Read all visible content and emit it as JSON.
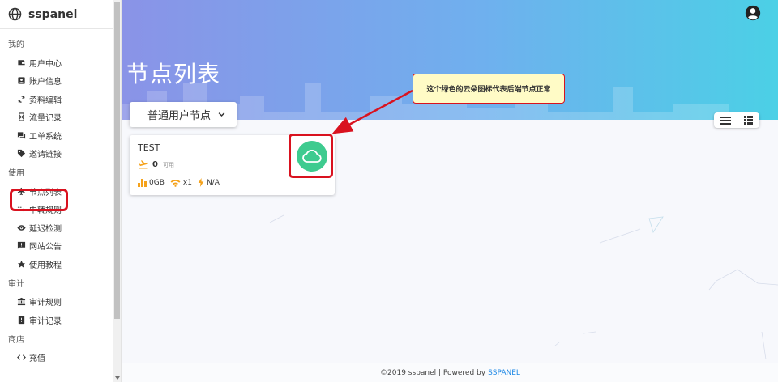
{
  "brand": {
    "name": "sspanel"
  },
  "sidebar": {
    "sections": [
      {
        "title": "我的",
        "items": [
          {
            "label": "用户中心",
            "icon": "wallet-icon"
          },
          {
            "label": "账户信息",
            "icon": "account-box-icon"
          },
          {
            "label": "资料编辑",
            "icon": "sync-icon"
          },
          {
            "label": "流量记录",
            "icon": "hourglass-icon"
          },
          {
            "label": "工单系统",
            "icon": "forum-icon"
          },
          {
            "label": "邀请链接",
            "icon": "tag-icon"
          }
        ]
      },
      {
        "title": "使用",
        "items": [
          {
            "label": "节点列表",
            "icon": "airplane-icon",
            "active": true
          },
          {
            "label": "中转规则",
            "icon": "transfer-icon"
          },
          {
            "label": "延迟检测",
            "icon": "eye-icon"
          },
          {
            "label": "网站公告",
            "icon": "announcement-icon"
          },
          {
            "label": "使用教程",
            "icon": "star-icon"
          }
        ]
      },
      {
        "title": "审计",
        "items": [
          {
            "label": "审计规则",
            "icon": "bank-icon"
          },
          {
            "label": "审计记录",
            "icon": "report-icon"
          }
        ]
      },
      {
        "title": "商店",
        "items": [
          {
            "label": "充值",
            "icon": "code-icon"
          }
        ]
      }
    ]
  },
  "header": {
    "page_title": "节点列表"
  },
  "group_select": {
    "value": "普通用户节点"
  },
  "node": {
    "name": "TEST",
    "online_count": "0",
    "online_label": "可用",
    "traffic": "0GB",
    "rate": "x1",
    "load": "N/A",
    "status_color": "#3ecb8f"
  },
  "annotation": {
    "text": "这个绿色的云朵图标代表后端节点正常"
  },
  "footer": {
    "text": "©2019 sspanel | Powered by",
    "link": "SSPANEL"
  },
  "colors": {
    "accent_red": "#d9121f",
    "hero_start": "#8a93e7",
    "hero_end": "#4bd0e6",
    "stat_orange": "#f5a21b"
  }
}
